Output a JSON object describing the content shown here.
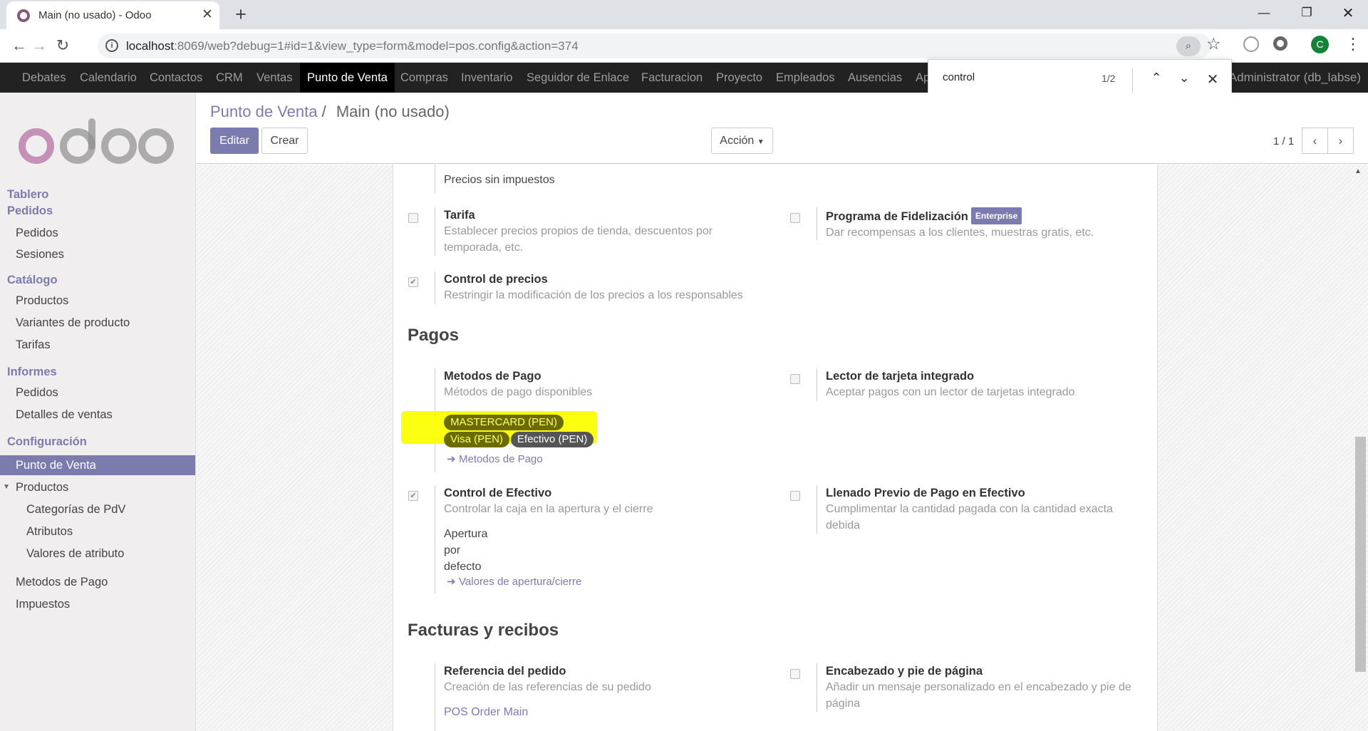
{
  "browser": {
    "tab_title": "Main (no usado) - Odoo",
    "url_host": "localhost",
    "url_path": ":8069/web?debug=1#id=1&view_type=form&model=pos.config&action=374",
    "profile_initial": "C"
  },
  "find": {
    "query": "control",
    "count": "1/2"
  },
  "navbar": {
    "items": [
      "Debates",
      "Calendario",
      "Contactos",
      "CRM",
      "Ventas",
      "Punto de Venta",
      "Compras",
      "Inventario",
      "Seguidor de Enlace",
      "Facturacion",
      "Proyecto",
      "Empleados",
      "Ausencias",
      "Ap"
    ],
    "active": "Punto de Venta",
    "user": "Administrator (db_labse)"
  },
  "sidebar": {
    "tablero": "Tablero",
    "pedidos_head": "Pedidos",
    "pedidos": "Pedidos",
    "sesiones": "Sesiones",
    "catalogo_head": "Catálogo",
    "productos": "Productos",
    "variantes": "Variantes de producto",
    "tarifas": "Tarifas",
    "informes_head": "Informes",
    "inf_pedidos": "Pedidos",
    "detalles": "Detalles de ventas",
    "config_head": "Configuración",
    "punto_venta": "Punto de Venta",
    "cfg_productos": "Productos",
    "categorias": "Categorías de PdV",
    "atributos": "Atributos",
    "valores": "Valores de atributo",
    "metodos": "Metodos de Pago",
    "impuestos": "Impuestos"
  },
  "control_panel": {
    "breadcrumb_parent": "Punto de Venta",
    "breadcrumb_sep": "/",
    "breadcrumb_current": "Main (no usado)",
    "edit": "Editar",
    "create": "Crear",
    "action": "Acción",
    "pager": "1 / 1"
  },
  "form": {
    "precios_sin_impuestos": "Precios sin impuestos",
    "tarifa": {
      "title": "Tarifa",
      "desc": "Establecer precios propios de tienda, descuentos por temporada, etc."
    },
    "fidelizacion": {
      "title": "Programa de Fidelización",
      "badge": "Enterprise",
      "desc": "Dar recompensas a los clientes, muestras gratis, etc."
    },
    "control_precios": {
      "title": "Control de precios",
      "desc": "Restringir la modificación de los precios a los responsables",
      "checked": true
    },
    "pagos_title": "Pagos",
    "metodos": {
      "title": "Metodos de Pago",
      "desc": "Métodos de pago disponibles",
      "link": "Metodos de Pago",
      "tags": [
        "MASTERCARD (PEN)",
        "Visa (PEN)",
        "Efectivo (PEN)"
      ]
    },
    "lector": {
      "title": "Lector de tarjeta integrado",
      "desc": "Aceptar pagos con un lector de tarjetas integrado"
    },
    "control_efectivo": {
      "title": "Control de Efectivo",
      "desc": "Controlar la caja en la apertura y el cierre",
      "checked": true,
      "apertura_1": "Apertura",
      "apertura_2": "por",
      "apertura_3": "defecto",
      "link": "Valores de apertura/cierre"
    },
    "llenado": {
      "title": "Llenado Previo de Pago en Efectivo",
      "desc": "Cumplimentar la cantidad pagada con la cantidad exacta debida"
    },
    "facturas_title": "Facturas y recibos",
    "referencia": {
      "title": "Referencia del pedido",
      "desc": "Creación de las referencias de su pedido",
      "value": "POS Order Main"
    },
    "encabezado": {
      "title": "Encabezado y pie de página",
      "desc": "Añadir un mensaje personalizado en el encabezado y pie de página"
    }
  }
}
